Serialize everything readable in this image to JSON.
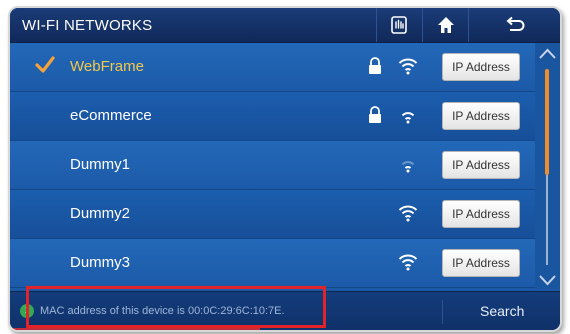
{
  "header": {
    "title": "WI-FI NETWORKS",
    "buttons": [
      {
        "name": "settings-hand-icon"
      },
      {
        "name": "home-icon"
      },
      {
        "name": "back-icon"
      }
    ]
  },
  "networks": [
    {
      "ssid": "WebFrame",
      "connected": true,
      "secured": true,
      "signal": "strong",
      "ip_label": "IP Address"
    },
    {
      "ssid": "eCommerce",
      "connected": false,
      "secured": true,
      "signal": "medium",
      "ip_label": "IP Address"
    },
    {
      "ssid": "Dummy1",
      "connected": false,
      "secured": false,
      "signal": "weak",
      "ip_label": "IP Address"
    },
    {
      "ssid": "Dummy2",
      "connected": false,
      "secured": false,
      "signal": "strong",
      "ip_label": "IP Address"
    },
    {
      "ssid": "Dummy3",
      "connected": false,
      "secured": false,
      "signal": "strong",
      "ip_label": "IP Address"
    }
  ],
  "status": {
    "message": "MAC address of this device is 00:0C:29:6C:10:7E.",
    "info_icon": "i"
  },
  "search": {
    "label": "Search"
  },
  "colors": {
    "accent_check": "#f5a23a",
    "connected_text": "#f2c84a",
    "highlight": "#e3232a",
    "scroll_thumb": "#f08c2a"
  }
}
